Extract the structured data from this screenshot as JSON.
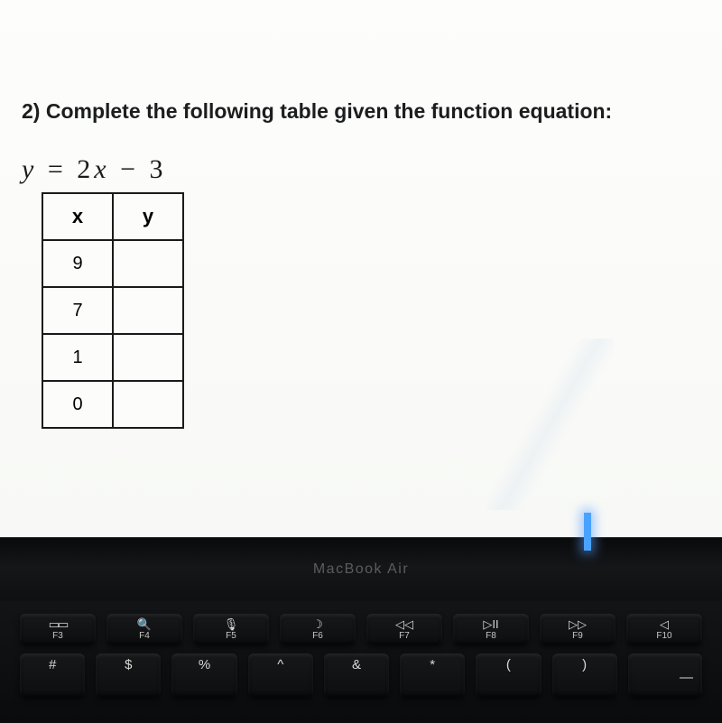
{
  "question": {
    "prompt": "2) Complete the following table given the function equation:",
    "equation": {
      "lhs": "y",
      "eq": "=",
      "coef": "2",
      "var": "x",
      "op": "−",
      "const": "3"
    },
    "table": {
      "headers": {
        "x": "x",
        "y": "y"
      },
      "rows": [
        {
          "x": "9",
          "y": ""
        },
        {
          "x": "7",
          "y": ""
        },
        {
          "x": "1",
          "y": ""
        },
        {
          "x": "0",
          "y": ""
        }
      ]
    }
  },
  "laptop": {
    "model": "MacBook Air",
    "function_keys": [
      {
        "name": "mission-control-icon",
        "icon": "⌘",
        "alt_icon": "▭▯",
        "label": "F3"
      },
      {
        "name": "search-icon",
        "icon": "🔍",
        "label": "F4"
      },
      {
        "name": "mic-icon",
        "icon": "🎙",
        "label": "F5"
      },
      {
        "name": "moon-icon",
        "icon": "☽",
        "label": "F6"
      },
      {
        "name": "rewind-icon",
        "icon": "◁◁",
        "label": "F7"
      },
      {
        "name": "play-pause-icon",
        "icon": "▷II",
        "label": "F8"
      },
      {
        "name": "forward-icon",
        "icon": "▷▷",
        "label": "F9"
      },
      {
        "name": "mute-icon",
        "icon": "◁",
        "label": "F10"
      }
    ],
    "number_keys": [
      {
        "sym": "#"
      },
      {
        "sym": "$"
      },
      {
        "sym": "%"
      },
      {
        "sym": "^"
      },
      {
        "sym": "&"
      },
      {
        "sym": "*"
      },
      {
        "sym": "("
      },
      {
        "sym": ")"
      },
      {
        "sym": "—"
      }
    ]
  }
}
